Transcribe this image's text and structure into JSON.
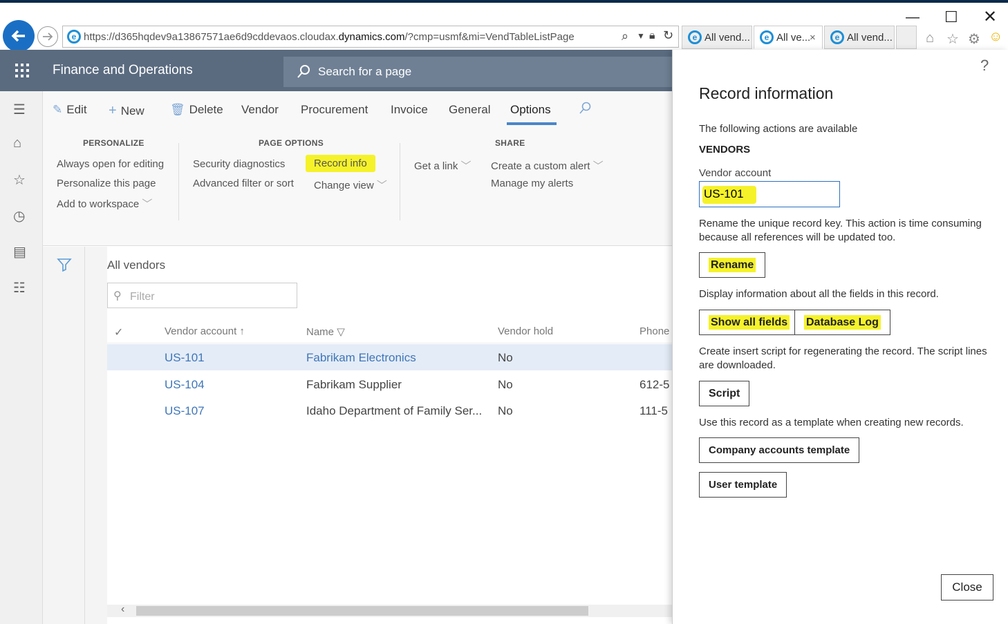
{
  "browser": {
    "url_prefix": "https://d365hqdev9a13867571ae6d9cddevaos.cloudax.",
    "url_domain": "dynamics.com",
    "url_suffix": "/?cmp=usmf&mi=VendTableListPage",
    "tabs": [
      {
        "label": "All vend..."
      },
      {
        "label": "All ve..."
      },
      {
        "label": "All vend..."
      }
    ],
    "active_tab_close": "×"
  },
  "app": {
    "title": "Finance and Operations",
    "search_placeholder": "Search for a page"
  },
  "actionpane": {
    "items": [
      "Edit",
      "New",
      "Delete",
      "Vendor",
      "Procurement",
      "Invoice",
      "General",
      "Options"
    ],
    "active_tab": "Options",
    "groups": {
      "personalize": {
        "header": "PERSONALIZE",
        "items": [
          "Always open for editing",
          "Personalize this page",
          "Add to workspace"
        ]
      },
      "page_options": {
        "header": "PAGE OPTIONS",
        "items": [
          "Security diagnostics",
          "Advanced filter or sort",
          "Record info",
          "Change view"
        ]
      },
      "share": {
        "header": "SHARE",
        "items": [
          "Get a link",
          "Create a custom alert",
          "Manage my alerts"
        ]
      }
    }
  },
  "grid": {
    "title": "All vendors",
    "filter_placeholder": "Filter",
    "columns": [
      "Vendor account",
      "Name",
      "Vendor hold",
      "Phone"
    ],
    "rows": [
      {
        "account": "US-101",
        "name": "Fabrikam Electronics",
        "hold": "No",
        "phone": "",
        "selected": true
      },
      {
        "account": "US-104",
        "name": "Fabrikam Supplier",
        "hold": "No",
        "phone": "612-5"
      },
      {
        "account": "US-107",
        "name": "Idaho Department of Family Ser...",
        "hold": "No",
        "phone": "111-5"
      }
    ]
  },
  "panel": {
    "help": "?",
    "title": "Record information",
    "intro": "The following actions are available",
    "entity": "VENDORS",
    "vendor_label": "Vendor account",
    "vendor_value": "US-101",
    "rename_desc": "Rename the unique record key. This action is time consuming because all references will be updated too.",
    "rename_btn": "Rename",
    "fields_desc": "Display information about all the fields in this record.",
    "show_all_fields_btn": "Show all fields",
    "database_log_btn": "Database Log",
    "script_desc": "Create insert script for regenerating the record. The script lines are downloaded.",
    "script_btn": "Script",
    "template_desc": "Use this record as a template when creating new records.",
    "company_template_btn": "Company accounts template",
    "user_template_btn": "User template",
    "close_btn": "Close"
  },
  "colors": {
    "highlight": "#f5f22a",
    "appbar": "#5a6b80",
    "link": "#3f76b8",
    "accent": "#4a86c8"
  }
}
